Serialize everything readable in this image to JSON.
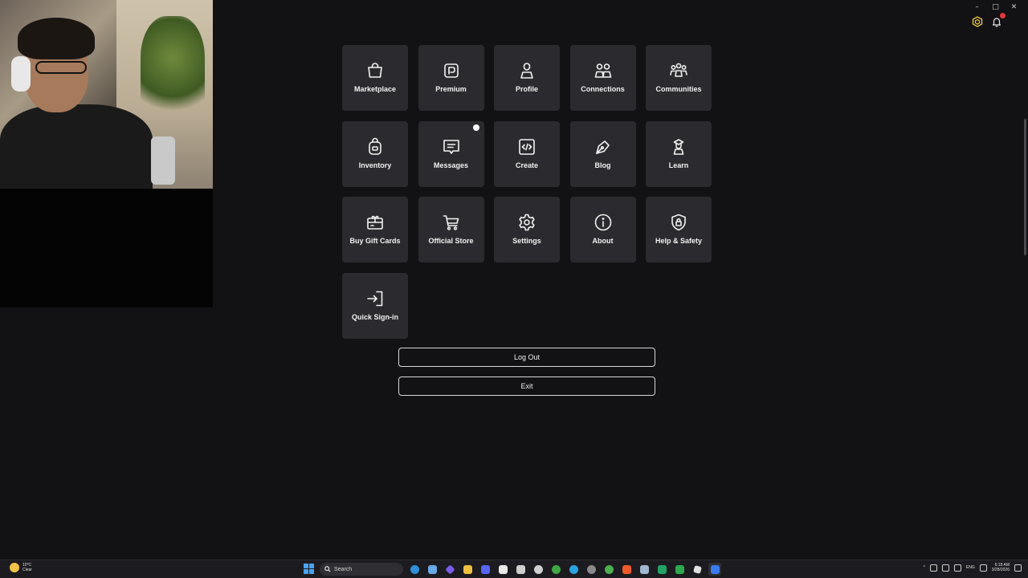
{
  "window": {
    "controls": {
      "minimize": "–",
      "maximize": "□",
      "close": "✕"
    },
    "notifications_badge": "1"
  },
  "menu": {
    "tiles": [
      {
        "label": "Marketplace",
        "icon": "shopping-bag-icon"
      },
      {
        "label": "Premium",
        "icon": "premium-icon"
      },
      {
        "label": "Profile",
        "icon": "profile-icon"
      },
      {
        "label": "Connections",
        "icon": "connections-icon"
      },
      {
        "label": "Communities",
        "icon": "communities-icon"
      },
      {
        "label": "Inventory",
        "icon": "backpack-icon"
      },
      {
        "label": "Messages",
        "icon": "message-icon",
        "has_notification": true
      },
      {
        "label": "Create",
        "icon": "code-icon"
      },
      {
        "label": "Blog",
        "icon": "pen-nib-icon"
      },
      {
        "label": "Learn",
        "icon": "graduation-icon"
      },
      {
        "label": "Buy Gift Cards",
        "icon": "gift-card-icon"
      },
      {
        "label": "Official Store",
        "icon": "cart-icon"
      },
      {
        "label": "Settings",
        "icon": "gear-icon"
      },
      {
        "label": "About",
        "icon": "info-icon"
      },
      {
        "label": "Help & Safety",
        "icon": "shield-lock-icon"
      },
      {
        "label": "Quick Sign-in",
        "icon": "sign-in-icon"
      }
    ],
    "log_out_label": "Log Out",
    "exit_label": "Exit"
  },
  "taskbar": {
    "weather_temp": "10°C",
    "weather_desc": "Clear",
    "search_placeholder": "Search",
    "language": "ENG",
    "time": "6:18 AM",
    "date": "3/28/2026",
    "apps": [
      {
        "icon": "edge-icon",
        "color": "#2f8fd8"
      },
      {
        "icon": "file-manager-icon",
        "color": "#6aa8e8"
      },
      {
        "icon": "media-icon",
        "color": "#7b5ce8"
      },
      {
        "icon": "folder-icon",
        "color": "#f0c040"
      },
      {
        "icon": "discord-icon",
        "color": "#5865f2"
      },
      {
        "icon": "notes-icon",
        "color": "#e8e8e8"
      },
      {
        "icon": "capture-icon",
        "color": "#cfcfcf"
      },
      {
        "icon": "obs-icon",
        "color": "#d0d0d0"
      },
      {
        "icon": "xbox-icon",
        "color": "#3ea843"
      },
      {
        "icon": "telegram-icon",
        "color": "#2aa3e0"
      },
      {
        "icon": "settings-app-icon",
        "color": "#8a8a8a"
      },
      {
        "icon": "chrome-icon",
        "color": "#4caf50"
      },
      {
        "icon": "brave-icon",
        "color": "#f05a28"
      },
      {
        "icon": "steam-icon",
        "color": "#9fb7d0"
      },
      {
        "icon": "excel-icon",
        "color": "#21a366"
      },
      {
        "icon": "sheets-icon",
        "color": "#2ea84f"
      },
      {
        "icon": "roblox-studio-icon",
        "color": "#e0e0e0"
      },
      {
        "icon": "roblox-icon",
        "color": "#3a7bf0"
      }
    ]
  }
}
